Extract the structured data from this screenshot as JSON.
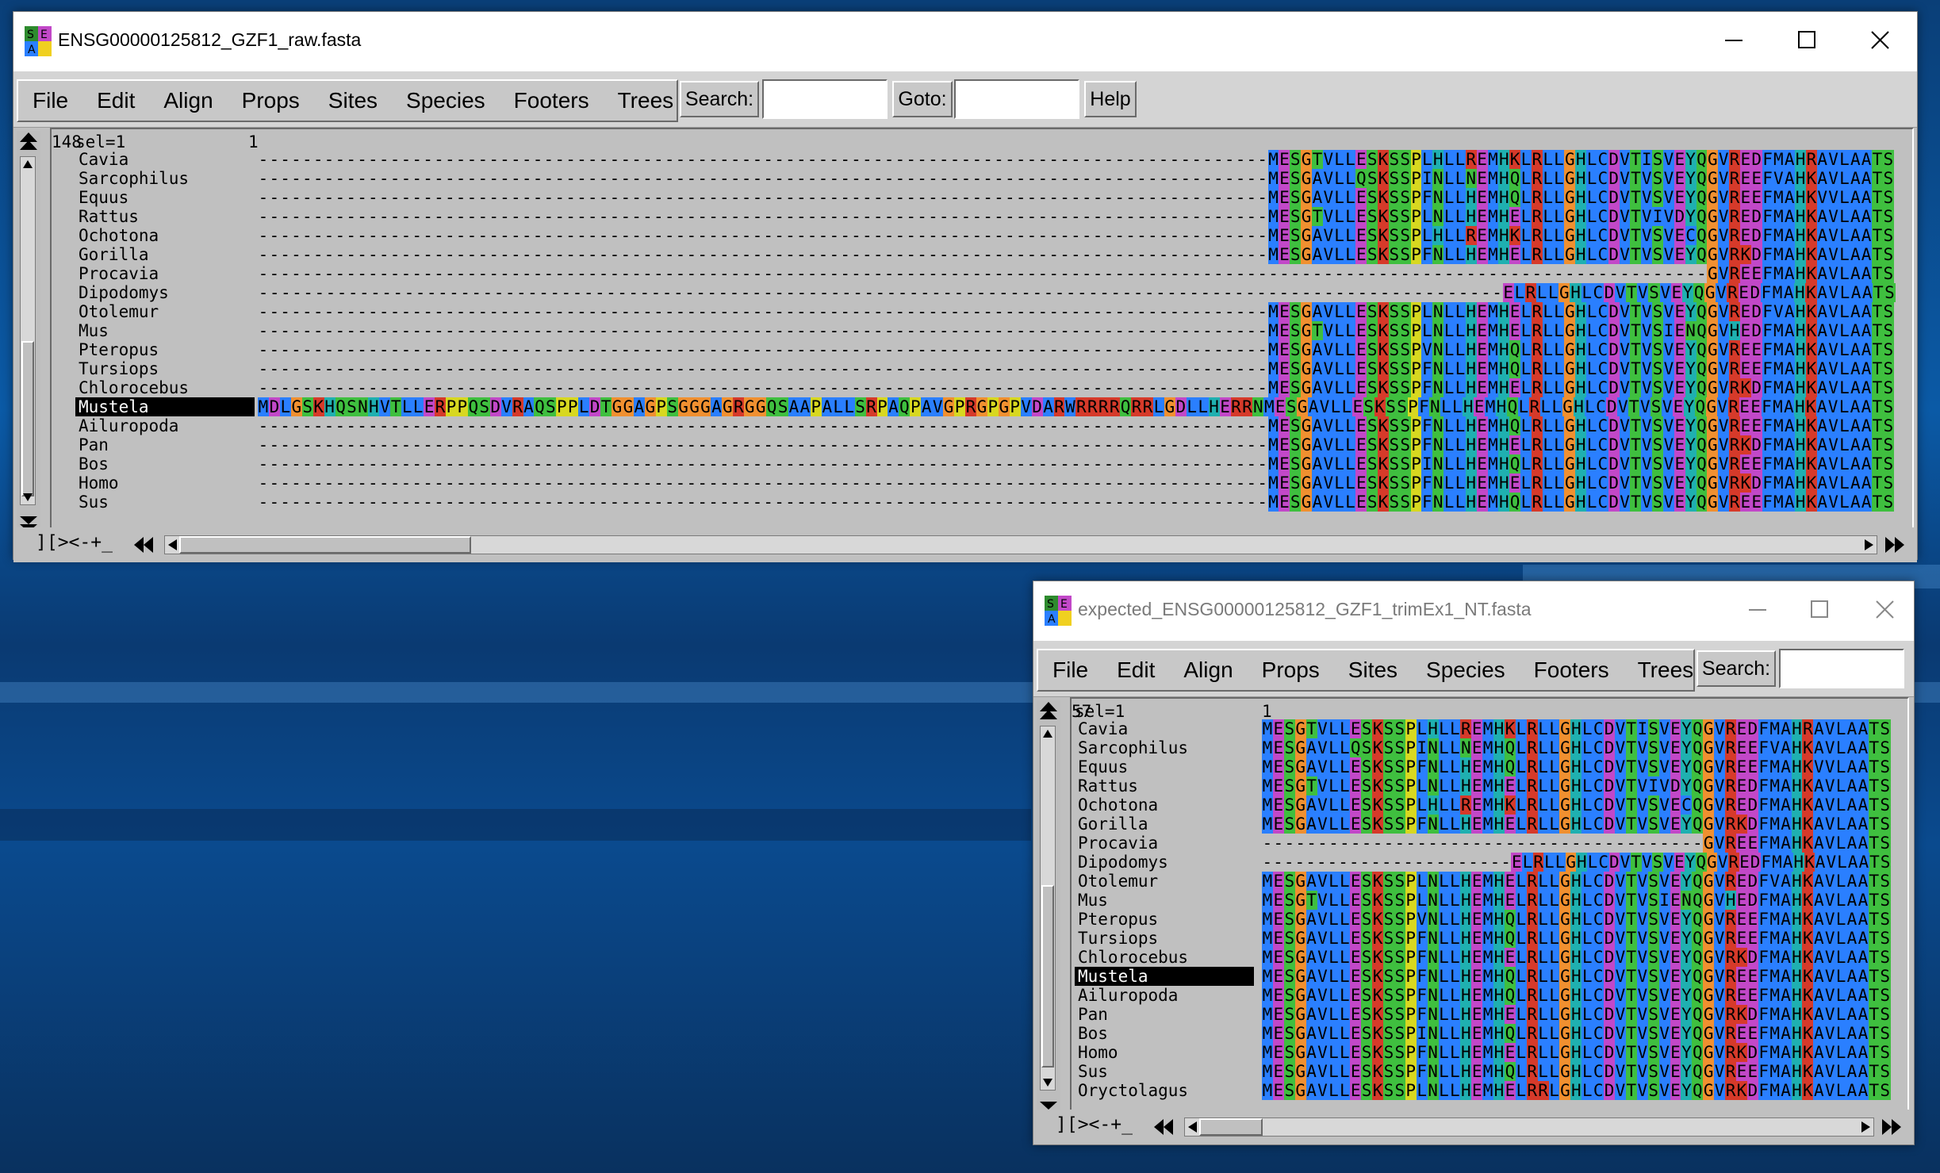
{
  "windows": [
    {
      "title": "ENSG00000125812_GZF1_raw.fasta",
      "menus": [
        "File",
        "Edit",
        "Align",
        "Props",
        "Sites",
        "Species",
        "Footers",
        "Trees"
      ],
      "search_label": "Search:",
      "goto_label": "Goto:",
      "help_label": "Help",
      "header": {
        "sel": "sel=1",
        "start": "1",
        "end": "148"
      },
      "status": "][><-+_",
      "selected": "Mustela",
      "rows": [
        {
          "name": "Cavia",
          "seq": "--------------------------------------------------------------------------------------------MESGTVLLESKSSPLHLLREMHKLRLLGHLCDVTISVEYQGVREDFMAHRAVLAATS"
        },
        {
          "name": "Sarcophilus",
          "seq": "--------------------------------------------------------------------------------------------MESGAVLLQSKSSPINLLNEMHQLRLLGHLCDVTVSVEYQGVREEFVAHKAVLAATS"
        },
        {
          "name": "Equus",
          "seq": "--------------------------------------------------------------------------------------------MESGAVLLESKSSPFNLLHEMHQLRLLGHLCDVTVSVEYQGVREEFMAHKVVLAATS"
        },
        {
          "name": "Rattus",
          "seq": "--------------------------------------------------------------------------------------------MESGTVLLESKSSPLNLLHEMHELRLLGHLCDVTVIVDYQGVREDFMAHKAVLAATS"
        },
        {
          "name": "Ochotona",
          "seq": "--------------------------------------------------------------------------------------------MESGAVLLESKSSPLHLLREMHKLRLLGHLCDVTVSVECQGVREDFMAHKAVLAATS"
        },
        {
          "name": "Gorilla",
          "seq": "--------------------------------------------------------------------------------------------MESGAVLLESKSSPFNLLHEMHELRLLGHLCDVTVSVEYQGVRKDFMAHKAVLAATS"
        },
        {
          "name": "Procavia",
          "seq": "------------------------------------------------------------------------------------------------------------------------------------GVREEFMAHKAVLAATS"
        },
        {
          "name": "Dipodomys",
          "seq": "---------------------------------------------------------------------------------------------------------------ELRLLGHLCDVTVSVEYQGVREDFMAHKAVLAATS"
        },
        {
          "name": "Otolemur",
          "seq": "--------------------------------------------------------------------------------------------MESGAVLLESKSSPLNLLHEMHELRLLGHLCDVTVSVEYQGVREDFVAHKAVLAATS"
        },
        {
          "name": "Mus",
          "seq": "--------------------------------------------------------------------------------------------MESGTVLLESKSSPLNLLHEMHELRLLGHLCDVTVSIENQGVHEDFMAHKAVLAATS"
        },
        {
          "name": "Pteropus",
          "seq": "--------------------------------------------------------------------------------------------MESGAVLLESKSSPVNLLHEMHQLRLLGHLCDVTVSVEYQGVREEFMAHKAVLAATS"
        },
        {
          "name": "Tursiops",
          "seq": "--------------------------------------------------------------------------------------------MESGAVLLESKSSPFNLLHEMHQLRLLGHLCDVTVSVEYQGVREEFMAHKAVLAATS"
        },
        {
          "name": "Chlorocebus",
          "seq": "--------------------------------------------------------------------------------------------MESGAVLLESKSSPFNLLHEMHELRLLGHLCDVTVSVEYQGVRKDFMAHKAVLAATS"
        },
        {
          "name": "Mustela",
          "seq": "MDLGSKHQSNHVTLLERPPQSDVRAQSPPLDTGGAGPSGGGAGRGGQSAAPALLSRPAQPAVGPRGPGPVDARWRRRRQRRLGDLLHERRNMESGAVLLESKSSPFNLLHEMHQLRLLGHLCDVTVSVEYQGVREEFMAHKAVLAATS"
        },
        {
          "name": "Ailuropoda",
          "seq": "--------------------------------------------------------------------------------------------MESGAVLLESKSSPFNLLHEMHQLRLLGHLCDVTVSVEYQGVREEFMAHKAVLAATS"
        },
        {
          "name": "Pan",
          "seq": "--------------------------------------------------------------------------------------------MESGAVLLESKSSPFNLLHEMHELRLLGHLCDVTVSVEYQGVRKDFMAHKAVLAATS"
        },
        {
          "name": "Bos",
          "seq": "--------------------------------------------------------------------------------------------MESGAVLLESKSSPINLLHEMHQLRLLGHLCDVTVSVEYQGVREEFMAHKAVLAATS"
        },
        {
          "name": "Homo",
          "seq": "--------------------------------------------------------------------------------------------MESGAVLLESKSSPFNLLHEMHELRLLGHLCDVTVSVEYQGVRKDFMAHKAVLAATS"
        },
        {
          "name": "Sus",
          "seq": "--------------------------------------------------------------------------------------------MESGAVLLESKSSPFNLLHEMHQLRLLGHLCDVTVSVEYQGVREEFMAHKAVLAATS"
        }
      ]
    },
    {
      "title": "expected_ENSG00000125812_GZF1_trimEx1_NT.fasta",
      "menus": [
        "File",
        "Edit",
        "Align",
        "Props",
        "Sites",
        "Species",
        "Footers",
        "Trees"
      ],
      "search_label": "Search:",
      "header": {
        "sel": "sel=1",
        "start": "1",
        "end": "57"
      },
      "status": "][><-+_",
      "selected": "Mustela",
      "rows": [
        {
          "name": "Cavia",
          "seq": "MESGTVLLESKSSPLHLLREMHKLRLLGHLCDVTISVEYQGVREDFMAHRAVLAATS"
        },
        {
          "name": "Sarcophilus",
          "seq": "MESGAVLLQSKSSPINLLNEMHQLRLLGHLCDVTVSVEYQGVREEFVAHKAVLAATS"
        },
        {
          "name": "Equus",
          "seq": "MESGAVLLESKSSPFNLLHEMHQLRLLGHLCDVTVSVEYQGVREEFMAHKVVLAATS"
        },
        {
          "name": "Rattus",
          "seq": "MESGTVLLESKSSPLNLLHEMHELRLLGHLCDVTVIVDYQGVREDFMAHKAVLAATS"
        },
        {
          "name": "Ochotona",
          "seq": "MESGAVLLESKSSPLHLLREMHKLRLLGHLCDVTVSVECQGVREDFMAHKAVLAATS"
        },
        {
          "name": "Gorilla",
          "seq": "MESGAVLLESKSSPFNLLHEMHELRLLGHLCDVTVSVEYQGVRKDFMAHKAVLAATS"
        },
        {
          "name": "Procavia",
          "seq": "----------------------------------------GVREEFMAHKAVLAATS"
        },
        {
          "name": "Dipodomys",
          "seq": "-----------------------ELRLLGHLCDVTVSVEYQGVREDFMAHKAVLAATS"
        },
        {
          "name": "Otolemur",
          "seq": "MESGAVLLESKSSPLNLLHEMHELRLLGHLCDVTVSVEYQGVREDFVAHKAVLAATS"
        },
        {
          "name": "Mus",
          "seq": "MESGTVLLESKSSPLNLLHEMHELRLLGHLCDVTVSIENQGVHEDFMAHKAVLAATS"
        },
        {
          "name": "Pteropus",
          "seq": "MESGAVLLESKSSPVNLLHEMHQLRLLGHLCDVTVSVEYQGVREEFMAHKAVLAATS"
        },
        {
          "name": "Tursiops",
          "seq": "MESGAVLLESKSSPFNLLHEMHQLRLLGHLCDVTVSVEYQGVREEFMAHKAVLAATS"
        },
        {
          "name": "Chlorocebus",
          "seq": "MESGAVLLESKSSPFNLLHEMHELRLLGHLCDVTVSVEYQGVRKDFMAHKAVLAATS"
        },
        {
          "name": "Mustela",
          "seq": "MESGAVLLESKSSPFNLLHEMHQLRLLGHLCDVTVSVEYQGVREEFMAHKAVLAATS"
        },
        {
          "name": "Ailuropoda",
          "seq": "MESGAVLLESKSSPFNLLHEMHQLRLLGHLCDVTVSVEYQGVREEFMAHKAVLAATS"
        },
        {
          "name": "Pan",
          "seq": "MESGAVLLESKSSPFNLLHEMHELRLLGHLCDVTVSVEYQGVRKDFMAHKAVLAATS"
        },
        {
          "name": "Bos",
          "seq": "MESGAVLLESKSSPINLLHEMHQLRLLGHLCDVTVSVEYQGVREEFMAHKAVLAATS"
        },
        {
          "name": "Homo",
          "seq": "MESGAVLLESKSSPFNLLHEMHELRLLGHLCDVTVSVEYQGVRKDFMAHKAVLAATS"
        },
        {
          "name": "Sus",
          "seq": "MESGAVLLESKSSPFNLLHEMHQLRLLGHLCDVTVSVEYQGVREEFMAHKAVLAATS"
        },
        {
          "name": "Oryctolagus",
          "seq": "MESGAVLLESKSSPLNLLHEMHELRRLGHLCDVTVSVEYQGVRKDFMAHKAVLAATS"
        }
      ]
    }
  ],
  "residue_colors": {
    "A": "#2a7fff",
    "V": "#2a7fff",
    "L": "#2a7fff",
    "I": "#2a7fff",
    "M": "#2a7fff",
    "F": "#2a7fff",
    "W": "#2a7fff",
    "C": "#2a7fff",
    "K": "#d63a2a",
    "R": "#d63a2a",
    "D": "#c248c8",
    "E": "#c248c8",
    "S": "#3fbf3f",
    "T": "#3fbf3f",
    "N": "#3fbf3f",
    "Q": "#3fbf3f",
    "G": "#f09030",
    "P": "#d8d820",
    "H": "#1fb0b0",
    "Y": "#1fb0b0"
  }
}
